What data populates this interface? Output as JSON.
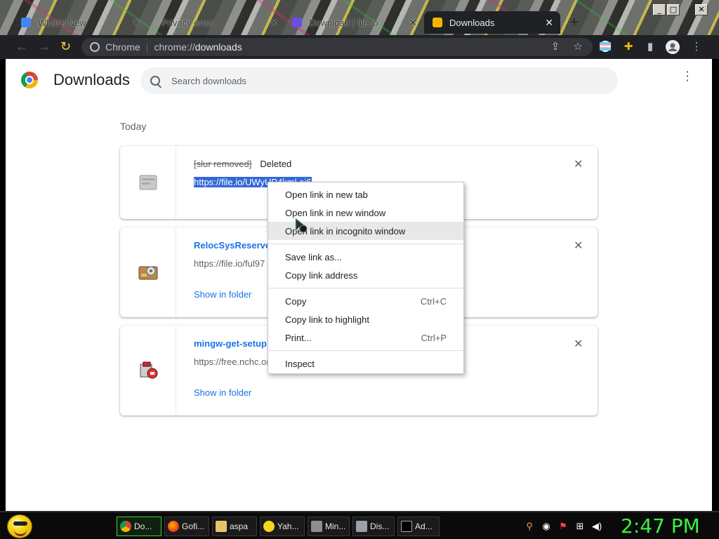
{
  "window": {
    "tabs": [
      {
        "label": "What's New",
        "active": false
      },
      {
        "label": "Privacy error",
        "active": false
      },
      {
        "label": "Download | file.io",
        "active": false
      },
      {
        "label": "Downloads",
        "active": true
      }
    ],
    "controls": {
      "minimize": "_",
      "maximize": "□",
      "close": "✕"
    }
  },
  "toolbar": {
    "omnibox_scheme": "Chrome",
    "omnibox_host_prefix": "chrome://",
    "omnibox_host": "downloads"
  },
  "page": {
    "title": "Downloads",
    "search_placeholder": "Search downloads",
    "section_label": "Today"
  },
  "downloads": [
    {
      "filename": "[slur removed]",
      "status": "Deleted",
      "url": "https://file.io/UWyUP4kml.ai6",
      "action": "",
      "icon": "deleted-file-icon"
    },
    {
      "filename": "RelocSysReserved",
      "status": "",
      "url": "https://file.io/ful97",
      "action": "Show in folder",
      "icon": "exe-file-icon"
    },
    {
      "filename": "mingw-get-setup.exe",
      "status": "",
      "url": "https://free.nchc.org",
      "action": "Show in folder",
      "icon": "installer-file-icon"
    }
  ],
  "context_menu": {
    "items": [
      {
        "label": "Open link in new tab",
        "shortcut": ""
      },
      {
        "label": "Open link in new window",
        "shortcut": ""
      },
      {
        "label": "Open link in incognito window",
        "shortcut": ""
      },
      {
        "label": "Save link as...",
        "shortcut": ""
      },
      {
        "label": "Copy link address",
        "shortcut": ""
      },
      {
        "label": "Copy",
        "shortcut": "Ctrl+C"
      },
      {
        "label": "Copy link to highlight",
        "shortcut": ""
      },
      {
        "label": "Print...",
        "shortcut": "Ctrl+P"
      },
      {
        "label": "Inspect",
        "shortcut": ""
      }
    ]
  },
  "taskbar": {
    "tasks": [
      {
        "label": "Do...",
        "icon": "chrome-icon",
        "active": true
      },
      {
        "label": "Gofi...",
        "icon": "firefox-icon",
        "active": false
      },
      {
        "label": "aspa",
        "icon": "folder-icon",
        "active": false
      },
      {
        "label": "Yah...",
        "icon": "yahoo-messenger-icon",
        "active": false
      },
      {
        "label": "Min...",
        "icon": "minecraft-icon",
        "active": false
      },
      {
        "label": "Dis...",
        "icon": "disk-icon",
        "active": false
      },
      {
        "label": "Ad...",
        "icon": "command-prompt-icon",
        "active": false
      }
    ],
    "clock": "2:47 PM"
  },
  "colors": {
    "accent": "#1a73e8",
    "selection": "#3367d6",
    "clock": "#3cf33c"
  }
}
